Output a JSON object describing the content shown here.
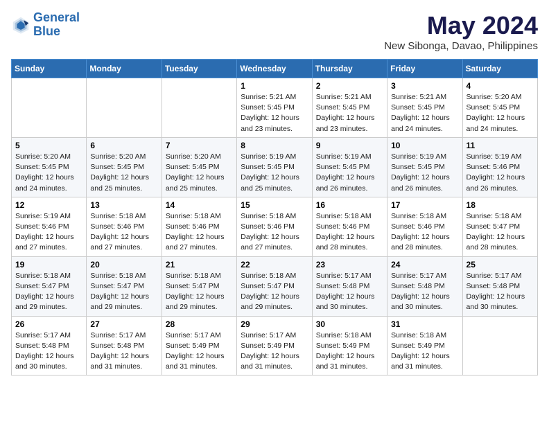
{
  "logo": {
    "line1": "General",
    "line2": "Blue"
  },
  "title": "May 2024",
  "subtitle": "New Sibonga, Davao, Philippines",
  "days_of_week": [
    "Sunday",
    "Monday",
    "Tuesday",
    "Wednesday",
    "Thursday",
    "Friday",
    "Saturday"
  ],
  "weeks": [
    {
      "days": [
        {
          "num": "",
          "info": ""
        },
        {
          "num": "",
          "info": ""
        },
        {
          "num": "",
          "info": ""
        },
        {
          "num": "1",
          "info": "Sunrise: 5:21 AM\nSunset: 5:45 PM\nDaylight: 12 hours\nand 23 minutes."
        },
        {
          "num": "2",
          "info": "Sunrise: 5:21 AM\nSunset: 5:45 PM\nDaylight: 12 hours\nand 23 minutes."
        },
        {
          "num": "3",
          "info": "Sunrise: 5:21 AM\nSunset: 5:45 PM\nDaylight: 12 hours\nand 24 minutes."
        },
        {
          "num": "4",
          "info": "Sunrise: 5:20 AM\nSunset: 5:45 PM\nDaylight: 12 hours\nand 24 minutes."
        }
      ]
    },
    {
      "days": [
        {
          "num": "5",
          "info": "Sunrise: 5:20 AM\nSunset: 5:45 PM\nDaylight: 12 hours\nand 24 minutes."
        },
        {
          "num": "6",
          "info": "Sunrise: 5:20 AM\nSunset: 5:45 PM\nDaylight: 12 hours\nand 25 minutes."
        },
        {
          "num": "7",
          "info": "Sunrise: 5:20 AM\nSunset: 5:45 PM\nDaylight: 12 hours\nand 25 minutes."
        },
        {
          "num": "8",
          "info": "Sunrise: 5:19 AM\nSunset: 5:45 PM\nDaylight: 12 hours\nand 25 minutes."
        },
        {
          "num": "9",
          "info": "Sunrise: 5:19 AM\nSunset: 5:45 PM\nDaylight: 12 hours\nand 26 minutes."
        },
        {
          "num": "10",
          "info": "Sunrise: 5:19 AM\nSunset: 5:45 PM\nDaylight: 12 hours\nand 26 minutes."
        },
        {
          "num": "11",
          "info": "Sunrise: 5:19 AM\nSunset: 5:46 PM\nDaylight: 12 hours\nand 26 minutes."
        }
      ]
    },
    {
      "days": [
        {
          "num": "12",
          "info": "Sunrise: 5:19 AM\nSunset: 5:46 PM\nDaylight: 12 hours\nand 27 minutes."
        },
        {
          "num": "13",
          "info": "Sunrise: 5:18 AM\nSunset: 5:46 PM\nDaylight: 12 hours\nand 27 minutes."
        },
        {
          "num": "14",
          "info": "Sunrise: 5:18 AM\nSunset: 5:46 PM\nDaylight: 12 hours\nand 27 minutes."
        },
        {
          "num": "15",
          "info": "Sunrise: 5:18 AM\nSunset: 5:46 PM\nDaylight: 12 hours\nand 27 minutes."
        },
        {
          "num": "16",
          "info": "Sunrise: 5:18 AM\nSunset: 5:46 PM\nDaylight: 12 hours\nand 28 minutes."
        },
        {
          "num": "17",
          "info": "Sunrise: 5:18 AM\nSunset: 5:46 PM\nDaylight: 12 hours\nand 28 minutes."
        },
        {
          "num": "18",
          "info": "Sunrise: 5:18 AM\nSunset: 5:47 PM\nDaylight: 12 hours\nand 28 minutes."
        }
      ]
    },
    {
      "days": [
        {
          "num": "19",
          "info": "Sunrise: 5:18 AM\nSunset: 5:47 PM\nDaylight: 12 hours\nand 29 minutes."
        },
        {
          "num": "20",
          "info": "Sunrise: 5:18 AM\nSunset: 5:47 PM\nDaylight: 12 hours\nand 29 minutes."
        },
        {
          "num": "21",
          "info": "Sunrise: 5:18 AM\nSunset: 5:47 PM\nDaylight: 12 hours\nand 29 minutes."
        },
        {
          "num": "22",
          "info": "Sunrise: 5:18 AM\nSunset: 5:47 PM\nDaylight: 12 hours\nand 29 minutes."
        },
        {
          "num": "23",
          "info": "Sunrise: 5:17 AM\nSunset: 5:48 PM\nDaylight: 12 hours\nand 30 minutes."
        },
        {
          "num": "24",
          "info": "Sunrise: 5:17 AM\nSunset: 5:48 PM\nDaylight: 12 hours\nand 30 minutes."
        },
        {
          "num": "25",
          "info": "Sunrise: 5:17 AM\nSunset: 5:48 PM\nDaylight: 12 hours\nand 30 minutes."
        }
      ]
    },
    {
      "days": [
        {
          "num": "26",
          "info": "Sunrise: 5:17 AM\nSunset: 5:48 PM\nDaylight: 12 hours\nand 30 minutes."
        },
        {
          "num": "27",
          "info": "Sunrise: 5:17 AM\nSunset: 5:48 PM\nDaylight: 12 hours\nand 31 minutes."
        },
        {
          "num": "28",
          "info": "Sunrise: 5:17 AM\nSunset: 5:49 PM\nDaylight: 12 hours\nand 31 minutes."
        },
        {
          "num": "29",
          "info": "Sunrise: 5:17 AM\nSunset: 5:49 PM\nDaylight: 12 hours\nand 31 minutes."
        },
        {
          "num": "30",
          "info": "Sunrise: 5:18 AM\nSunset: 5:49 PM\nDaylight: 12 hours\nand 31 minutes."
        },
        {
          "num": "31",
          "info": "Sunrise: 5:18 AM\nSunset: 5:49 PM\nDaylight: 12 hours\nand 31 minutes."
        },
        {
          "num": "",
          "info": ""
        }
      ]
    }
  ]
}
